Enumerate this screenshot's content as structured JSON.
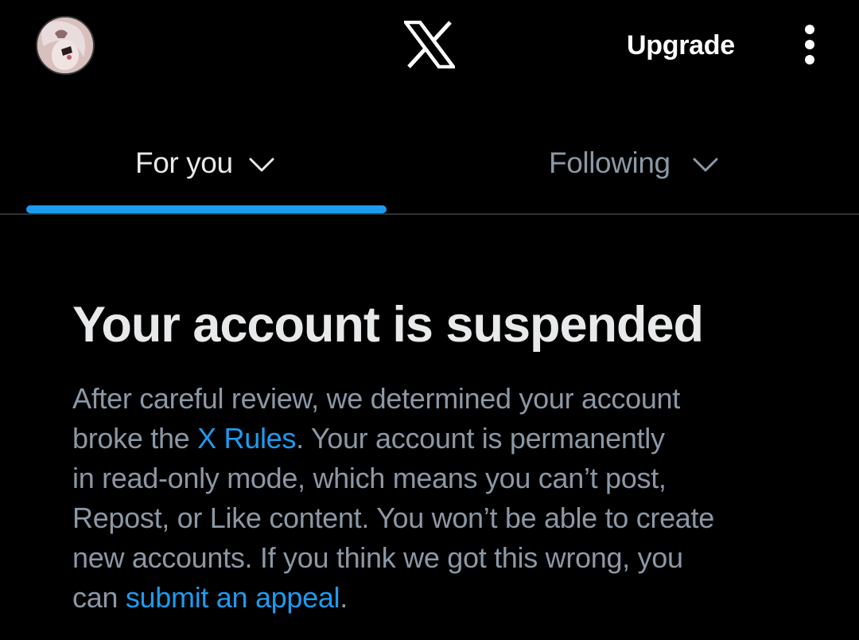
{
  "header": {
    "logo_icon": "x-logo-icon",
    "avatar_icon": "avatar",
    "upgrade_label": "Upgrade",
    "more_icon": "more-vertical-icon"
  },
  "tabs": [
    {
      "label": "For you",
      "selected": true,
      "icon": "chevron-down-icon"
    },
    {
      "label": "Following",
      "selected": false,
      "icon": "chevron-down-icon"
    }
  ],
  "notice": {
    "title": "Your account is suspended",
    "line1": "After careful review, we determined your account",
    "line2_pre": "broke the ",
    "rules_link": "X Rules",
    "line2_post": ". Your account is permanently",
    "line3": "in read-only mode, which means you can’t post,",
    "line4": "Repost, or Like content. You won’t be able to create",
    "line5": "new accounts. If you think we got this wrong, you",
    "line6_pre": "can ",
    "appeal_link": "submit an appeal",
    "line6_post": "."
  },
  "colors": {
    "background": "#000000",
    "accent": "#1d9bf0",
    "primary_text": "#e7e9ea",
    "secondary_text": "#8b98a5",
    "divider": "#2f3336"
  }
}
